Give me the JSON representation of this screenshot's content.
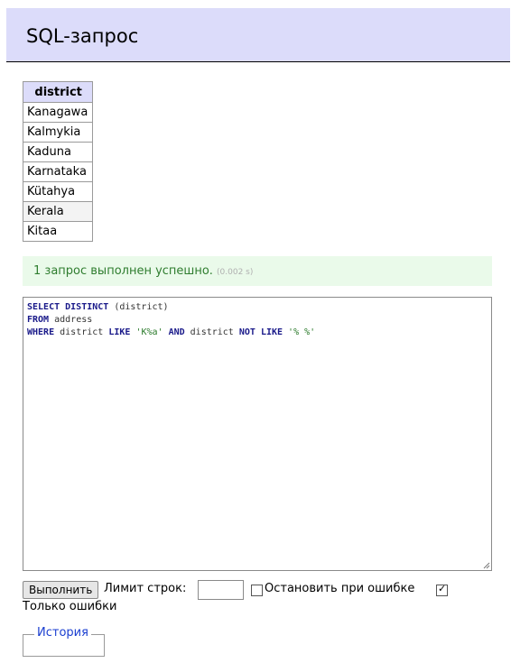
{
  "header": {
    "title": "SQL-запрос"
  },
  "result_table": {
    "column": "district",
    "rows": [
      "Kanagawa",
      "Kalmykia",
      "Kaduna",
      "Karnataka",
      "Kütahya",
      "Kerala",
      "Kitaa"
    ]
  },
  "message": {
    "text": "1 запрос выполнен успешно.",
    "time": "(0.002 s)"
  },
  "query": {
    "line1": {
      "kw": "SELECT DISTINCT",
      "rest": " (district)"
    },
    "line2": {
      "kw": "FROM",
      "rest": " address"
    },
    "line3": {
      "kw1": "WHERE",
      "t1": " district ",
      "kw2": "LIKE",
      "s1": " 'K%a'",
      "kw3": " AND",
      "t2": " district ",
      "kw4": "NOT LIKE",
      "s2": " '% %'"
    }
  },
  "controls": {
    "run_label": "Выполнить",
    "limit_label": "Лимит строк:",
    "limit_value": "",
    "stop_on_error_label": "Остановить при ошибке",
    "stop_on_error_checked": false,
    "errors_only_label": "Только ошибки",
    "errors_only_checked": true
  },
  "history": {
    "legend": "История"
  },
  "colors": {
    "header_bg": "#dcdcfa",
    "success_bg": "#eafaea",
    "success_text": "#2f7d2f",
    "keyword": "#1a1a8a",
    "string": "#2a7a2a",
    "link": "#1a3ed0"
  }
}
